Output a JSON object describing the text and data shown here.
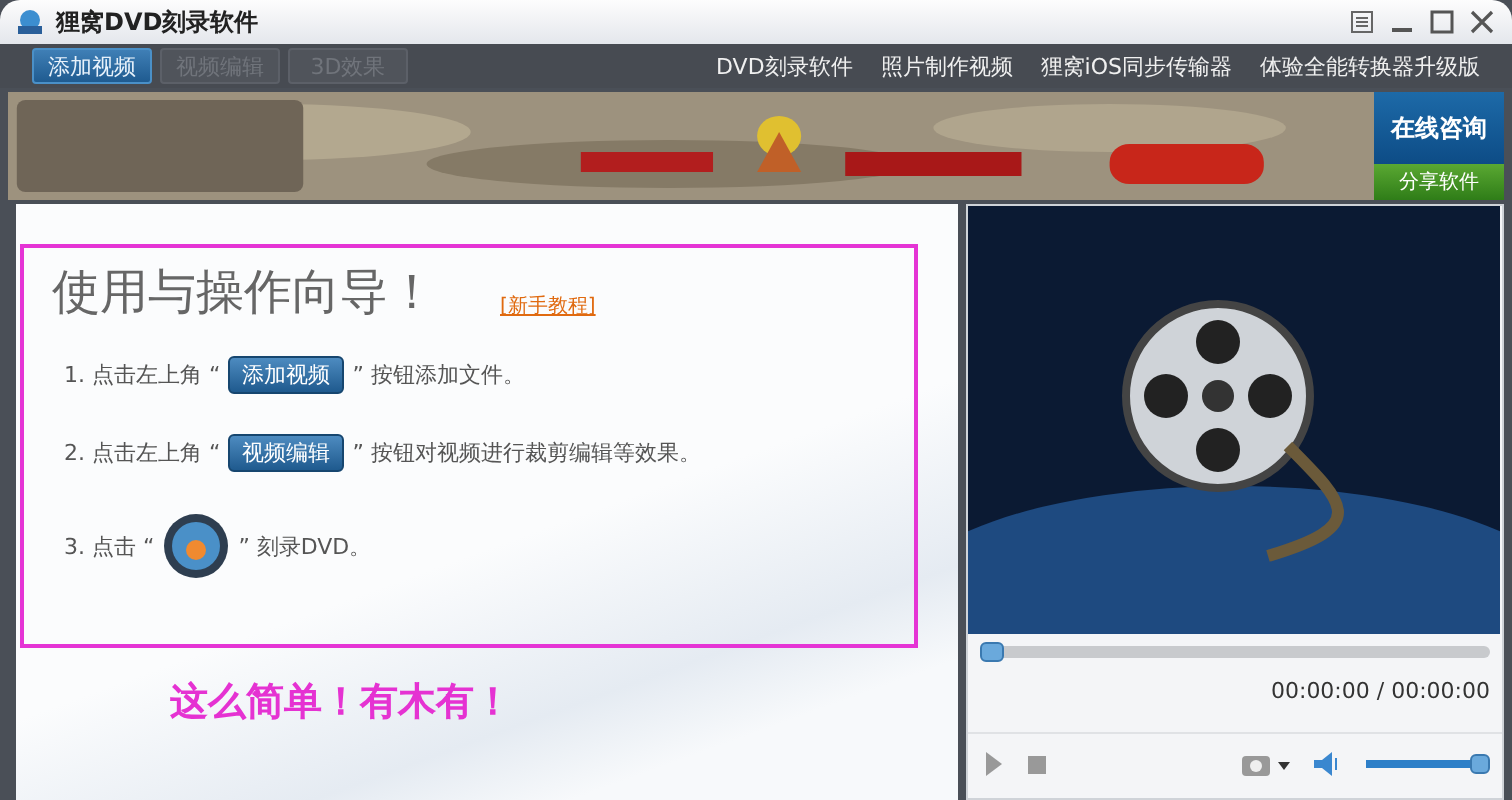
{
  "window": {
    "title": "狸窝DVD刻录软件"
  },
  "tabs": [
    {
      "label": "添加视频",
      "selected": true,
      "disabled": false
    },
    {
      "label": "视频编辑",
      "selected": false,
      "disabled": true
    },
    {
      "label": "3D效果",
      "selected": false,
      "disabled": true
    }
  ],
  "top_links": [
    "DVD刻录软件",
    "照片制作视频",
    "狸窝iOS同步传输器",
    "体验全能转换器升级版"
  ],
  "banner": {
    "kind": "picture",
    "consult": "在线咨询",
    "share": "分享软件"
  },
  "guide": {
    "title": "使用与操作向导！",
    "tutorial_link": "[新手教程]",
    "steps": [
      {
        "kind": "button",
        "prefix": "1. 点击左上角 “",
        "button": "添加视频",
        "suffix": "” 按钮添加文件。"
      },
      {
        "kind": "button",
        "prefix": "2. 点击左上角 “",
        "button": "视频编辑",
        "suffix": "” 按钮对视频进行裁剪编辑等效果。"
      },
      {
        "kind": "disc",
        "prefix": "3. 点击 “",
        "suffix": "” 刻录DVD。"
      }
    ],
    "slogan": "这么简单！有木有！"
  },
  "player": {
    "progress": {
      "level": 0.0
    },
    "time": "00:00:00 / 00:00:00",
    "volume": {
      "level": 0.95
    }
  }
}
